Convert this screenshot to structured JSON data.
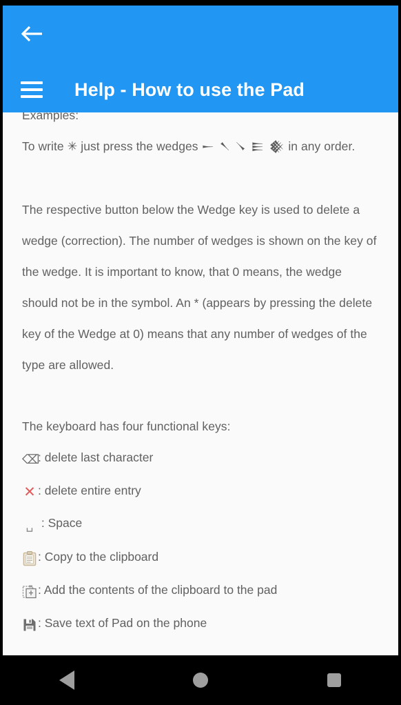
{
  "theme": {
    "appbar_color": "#2196f3",
    "content_background": "#fafafa",
    "text_color": "#616161",
    "accent_red": "#e05c5c",
    "navbar_color": "#000000",
    "nav_icon_color": "#9e9e9e"
  },
  "appbar": {
    "back_icon": "arrow-left-icon",
    "menu_icon": "hamburger-menu-icon",
    "title": "Help - How to use the Pad"
  },
  "content": {
    "clipped_top_line": "Examples:",
    "example_line_part1": "To write",
    "example_symbol": "✳",
    "example_line_part2": "just press the wedges",
    "example_wedges": "𒀸 𒀹 𒀺 𒀼 𒀽",
    "example_line_part3": "in any",
    "example_line_part4": "order.",
    "paragraph": "The respective button below the Wedge key is used to delete a wedge (correction). The number of wedges is shown on the key of the wedge. It is important to know, that 0 means, the wedge should not be in the symbol. An * (appears by pressing the delete key of the Wedge at 0) means that any number of wedges of the type are allowed.",
    "keys_intro": "The keyboard has four functional keys:",
    "keys": [
      {
        "icon": "backspace-icon",
        "glyph": "⌫",
        "label": ": delete last character"
      },
      {
        "icon": "red-x-icon",
        "glyph": "✕",
        "label": ": delete entire entry"
      },
      {
        "icon": "space-icon",
        "glyph": "␣",
        "label": " : Space"
      },
      {
        "icon": "clipboard-icon",
        "glyph": "",
        "label": ": Copy to the clipboard"
      },
      {
        "icon": "paste-icon",
        "glyph": "",
        "label": ": Add the contents of the clipboard to the pad"
      },
      {
        "icon": "floppy-save-icon",
        "glyph": "",
        "label": ": Save text of Pad on the phone"
      }
    ]
  },
  "navbar": {
    "back_label": "Back",
    "home_label": "Home",
    "recents_label": "Recents"
  }
}
